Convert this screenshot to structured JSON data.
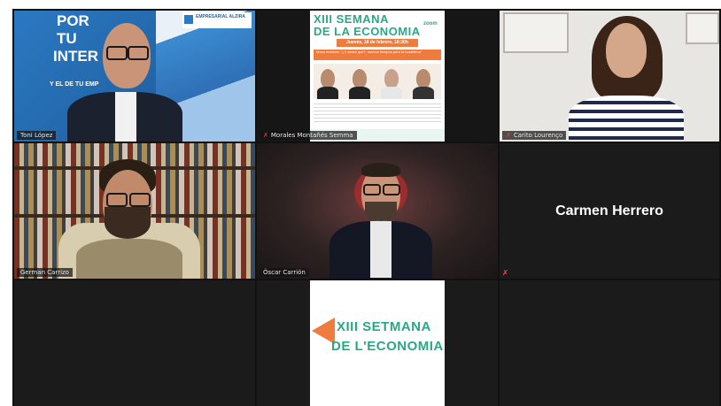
{
  "participants": {
    "p1": {
      "name": "Toni López",
      "muted": false,
      "active_speaker": true
    },
    "p2": {
      "name": "Morales Montañés Semma",
      "muted": true
    },
    "p3": {
      "name": "Carito Lourenço",
      "muted": true
    },
    "p4": {
      "name": "German Carrizo",
      "muted": false
    },
    "p5": {
      "name": "Óscar Carrión",
      "muted": false
    },
    "p6": {
      "name": "Carmen Herrero",
      "muted": true
    }
  },
  "banner_p1": {
    "line1": "POR",
    "line2": "TU",
    "line3": "INTER",
    "line4": "Y EL DE TU EMP",
    "logo_text": "EMPRESARIAL ALZIRA"
  },
  "poster_small": {
    "title1": "XIII SEMANA",
    "title2": "DE LA ECONOMIA",
    "date": "Jueves, 18 de febrero, 18:30h",
    "zoom": "zoom",
    "band": "Mesa redonda: \"¿Y ahora qué?, nuevos tiempos para la hostelería\""
  },
  "poster_large": {
    "title1": "XIII SETMANA",
    "title2": "DE L'ECONOMIA"
  },
  "colors": {
    "active_border": "#a3d93c",
    "muted_icon": "#e53935",
    "poster_green": "#2aa886",
    "poster_orange": "#f07b3f"
  }
}
